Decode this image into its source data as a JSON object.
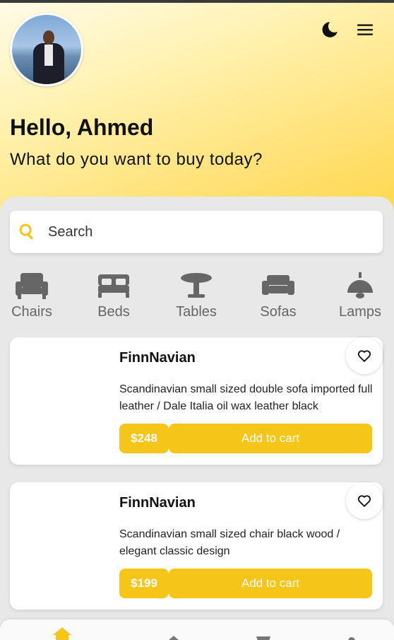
{
  "header": {
    "greeting": "Hello, Ahmed",
    "subtitle": "What do you want to buy today?",
    "avatar_icon": "user-photo",
    "theme_toggle_icon": "moon-icon",
    "menu_icon": "hamburger-menu-icon"
  },
  "search": {
    "placeholder": "Search",
    "icon": "search-icon"
  },
  "categories": [
    {
      "label": "Chairs",
      "icon": "armchair-icon"
    },
    {
      "label": "Beds",
      "icon": "bed-icon"
    },
    {
      "label": "Tables",
      "icon": "table-icon"
    },
    {
      "label": "Sofas",
      "icon": "sofa-icon"
    },
    {
      "label": "Lamps",
      "icon": "lamp-icon"
    }
  ],
  "products": [
    {
      "brand": "FinnNavian",
      "description": "Scandinavian small sized double sofa imported full leather / Dale Italia oil wax leather black",
      "price": "$248",
      "add_label": "Add to cart"
    },
    {
      "brand": "FinnNavian",
      "description": "Scandinavian small sized chair black wood / elegant classic design",
      "price": "$199",
      "add_label": "Add to cart"
    }
  ],
  "bottom_nav": [
    {
      "icon": "home-icon",
      "active": true
    },
    {
      "icon": "tag-icon",
      "active": false
    },
    {
      "icon": "cart-icon",
      "active": false
    },
    {
      "icon": "profile-icon",
      "active": false
    }
  ],
  "colors": {
    "accent": "#f5c518",
    "header_gradient_start": "#fffbe6",
    "header_gradient_end": "#ffd84d",
    "background": "#e8e8e8",
    "text": "#111111"
  }
}
